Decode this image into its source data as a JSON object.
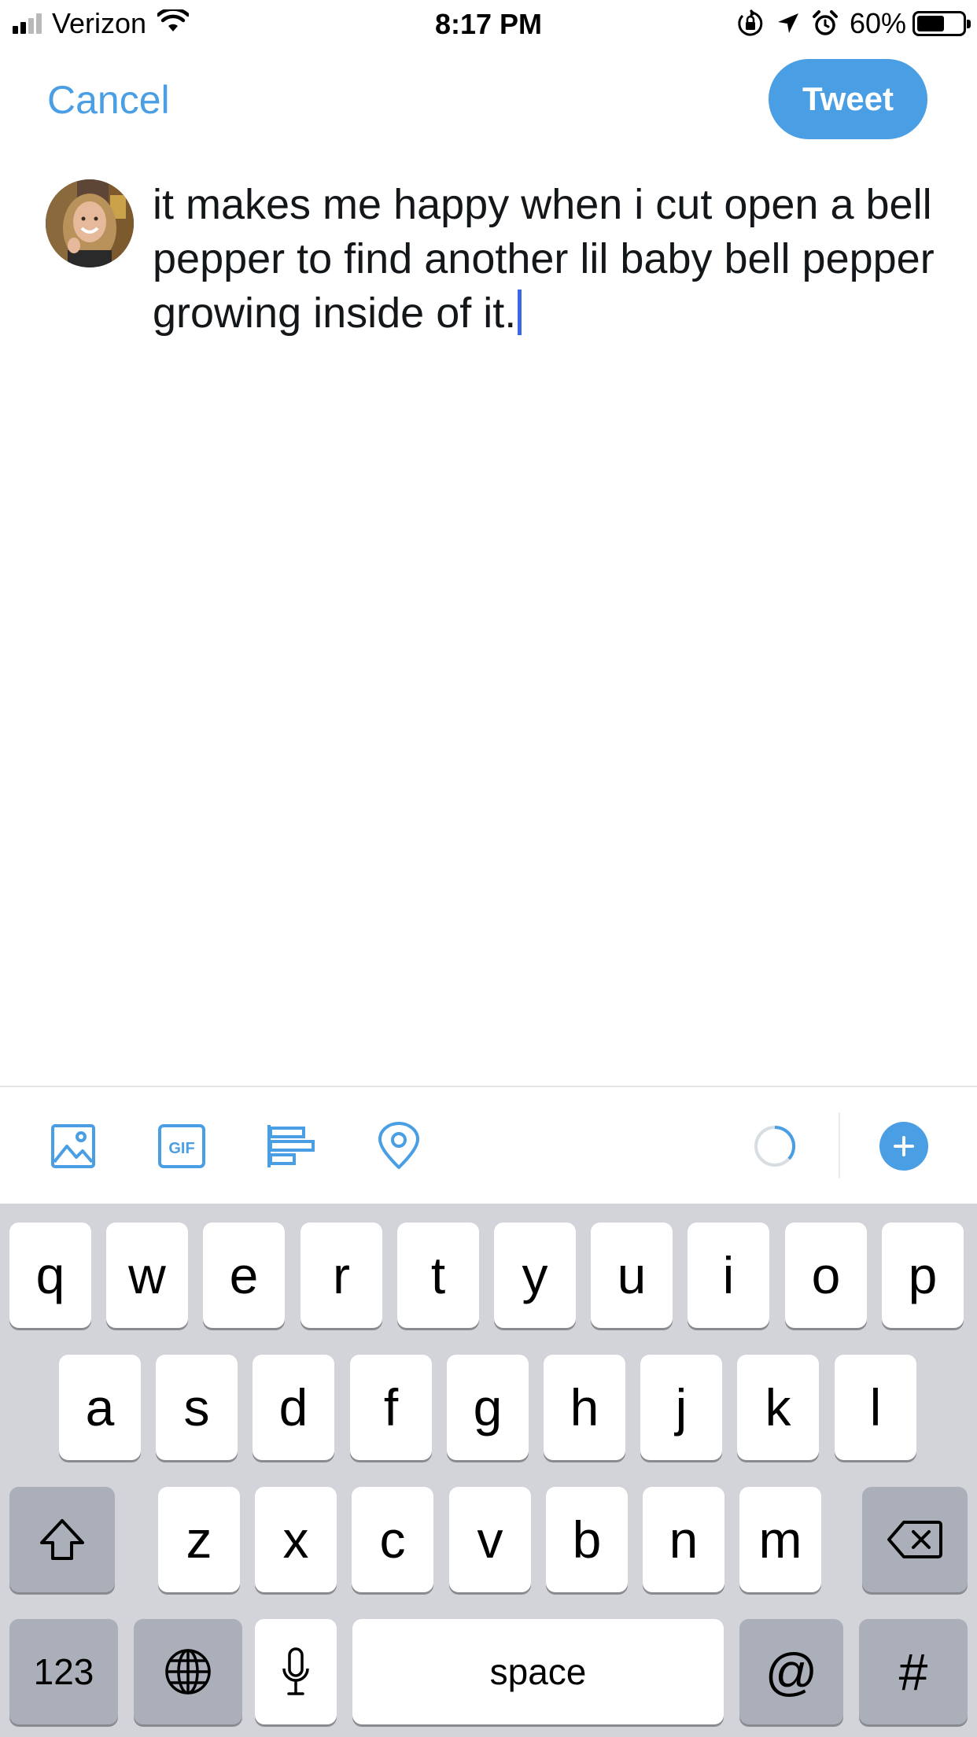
{
  "status_bar": {
    "carrier": "Verizon",
    "time": "8:17 PM",
    "battery_percent": "60%",
    "battery_level": 0.6,
    "signal_bars_filled": 2,
    "signal_bars_total": 4
  },
  "nav": {
    "cancel_label": "Cancel",
    "tweet_label": "Tweet"
  },
  "compose": {
    "text": "it makes me happy when i cut open a bell pepper to find another lil baby bell pepper growing inside of it."
  },
  "toolbar": {
    "gif_label": "GIF",
    "icons": [
      "image-icon",
      "gif-icon",
      "poll-icon",
      "location-icon",
      "character-count-ring-icon",
      "add-thread-icon"
    ]
  },
  "keyboard": {
    "row1": [
      "q",
      "w",
      "e",
      "r",
      "t",
      "y",
      "u",
      "i",
      "o",
      "p"
    ],
    "row2": [
      "a",
      "s",
      "d",
      "f",
      "g",
      "h",
      "j",
      "k",
      "l"
    ],
    "row3": [
      "z",
      "x",
      "c",
      "v",
      "b",
      "n",
      "m"
    ],
    "numbers_label": "123",
    "space_label": "space",
    "at_label": "@",
    "hash_label": "#"
  },
  "colors": {
    "accent": "#4a9ee3",
    "text": "#14171a",
    "caret": "#3b66e8",
    "keyboard_bg": "#d2d4da",
    "key_dark": "#abafba"
  }
}
